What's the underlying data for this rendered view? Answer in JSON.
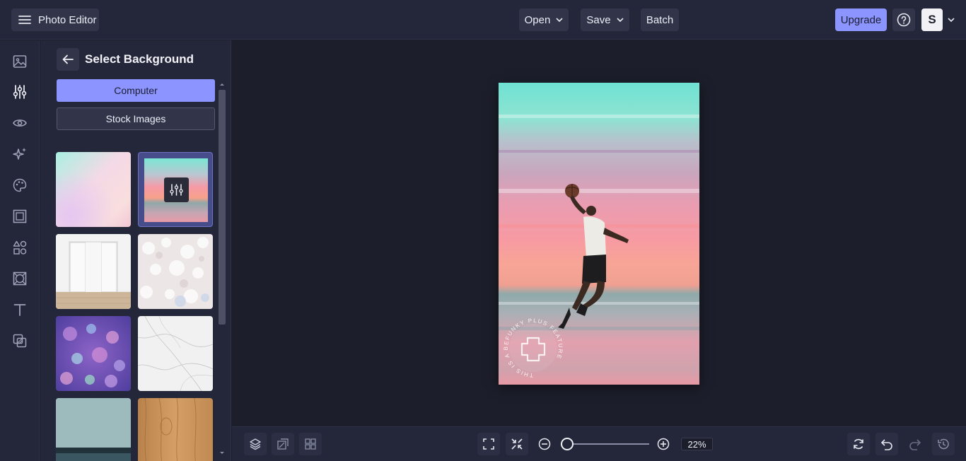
{
  "topbar": {
    "app_title": "Photo Editor",
    "open_label": "Open",
    "save_label": "Save",
    "batch_label": "Batch",
    "upgrade_label": "Upgrade",
    "avatar_initial": "S"
  },
  "rail": {
    "icons": [
      "image-icon",
      "sliders-icon",
      "eye-icon",
      "sparkle-icon",
      "palette-icon",
      "frame-icon",
      "shapes-icon",
      "texture-icon",
      "text-icon",
      "layers-overlay-icon"
    ]
  },
  "panel": {
    "title": "Select Background",
    "computer_label": "Computer",
    "stock_label": "Stock Images",
    "thumbnails": [
      "gradient-pastel",
      "sunset-sea (selected)",
      "white-room",
      "bokeh-light",
      "purple-bokeh",
      "marble",
      "teal-wall",
      "wood"
    ]
  },
  "bottombar": {
    "zoom_value": "22%",
    "zoom_fraction": 0.05
  },
  "watermark": {
    "text": "THIS IS A BEFUNKY PLUS FEATURE"
  },
  "colors": {
    "accent": "#8c94ff",
    "bg_dark": "#1c1e2b",
    "panel": "#24263a"
  }
}
